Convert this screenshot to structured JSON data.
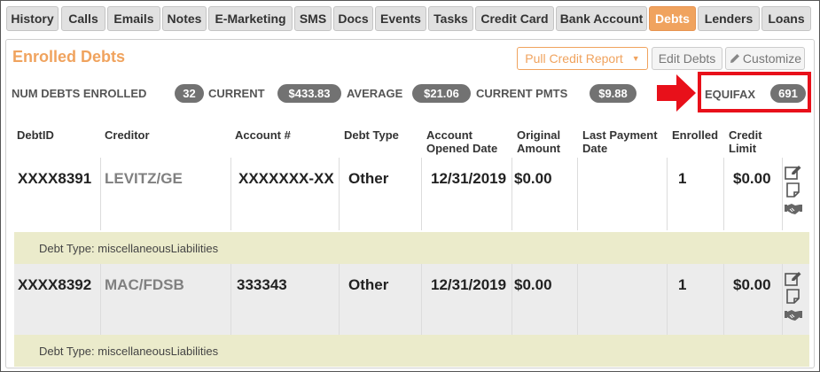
{
  "tabs": [
    {
      "label": "History",
      "active": false
    },
    {
      "label": "Calls",
      "active": false
    },
    {
      "label": "Emails",
      "active": false
    },
    {
      "label": "Notes",
      "active": false
    },
    {
      "label": "E-Marketing",
      "active": false
    },
    {
      "label": "SMS",
      "active": false
    },
    {
      "label": "Docs",
      "active": false
    },
    {
      "label": "Events",
      "active": false
    },
    {
      "label": "Tasks",
      "active": false
    },
    {
      "label": "Credit Card",
      "active": false
    },
    {
      "label": "Bank Account",
      "active": false
    },
    {
      "label": "Debts",
      "active": true
    },
    {
      "label": "Lenders",
      "active": false
    },
    {
      "label": "Loans",
      "active": false
    }
  ],
  "panel": {
    "title": "Enrolled Debts",
    "pull_credit_label": "Pull Credit Report",
    "edit_debts_label": "Edit Debts",
    "customize_label": "Customize"
  },
  "stats": {
    "num_debts_label": "NUM DEBTS ENROLLED",
    "num_debts_value": "32",
    "current_label": "CURRENT",
    "current_value": "$433.83",
    "average_label": "AVERAGE",
    "average_value": "$21.06",
    "current_pmts_label": "CURRENT PMTS",
    "current_pmts_value": "$9.88",
    "equifax_label": "EQUIFAX",
    "equifax_value": "691"
  },
  "table": {
    "headers": [
      "DebtID",
      "Creditor",
      "Account #",
      "Debt Type",
      "Account Opened Date",
      "Original Amount",
      "Last Payment Date",
      "Enrolled",
      "Credit Limit"
    ],
    "rows": [
      {
        "debt_id_mask": "XXXX",
        "debt_id_suffix": "8391",
        "creditor": "LEVITZ/GE",
        "account": "XXXXXXX-XX",
        "debt_type": "Other",
        "opened": "12/31/2019",
        "original_amount": "$0.00",
        "last_payment": "",
        "enrolled": "1",
        "credit_limit": "$0.00",
        "detail": "Debt Type: miscellaneousLiabilities"
      },
      {
        "debt_id_mask": "XXXX",
        "debt_id_suffix": "8392",
        "creditor": "MAC/FDSB",
        "account": "333343",
        "debt_type": "Other",
        "opened": "12/31/2019",
        "original_amount": "$0.00",
        "last_payment": "",
        "enrolled": "1",
        "credit_limit": "$0.00",
        "detail": "Debt Type: miscellaneousLiabilities"
      }
    ]
  },
  "colors": {
    "accent": "#f0a35e",
    "badge": "#727272",
    "highlight": "#e8101a",
    "detail_bg": "#ebebcb"
  },
  "icons": [
    "edit-icon",
    "note-icon",
    "handshake-icon",
    "pencil-icon",
    "caret-down-icon"
  ]
}
